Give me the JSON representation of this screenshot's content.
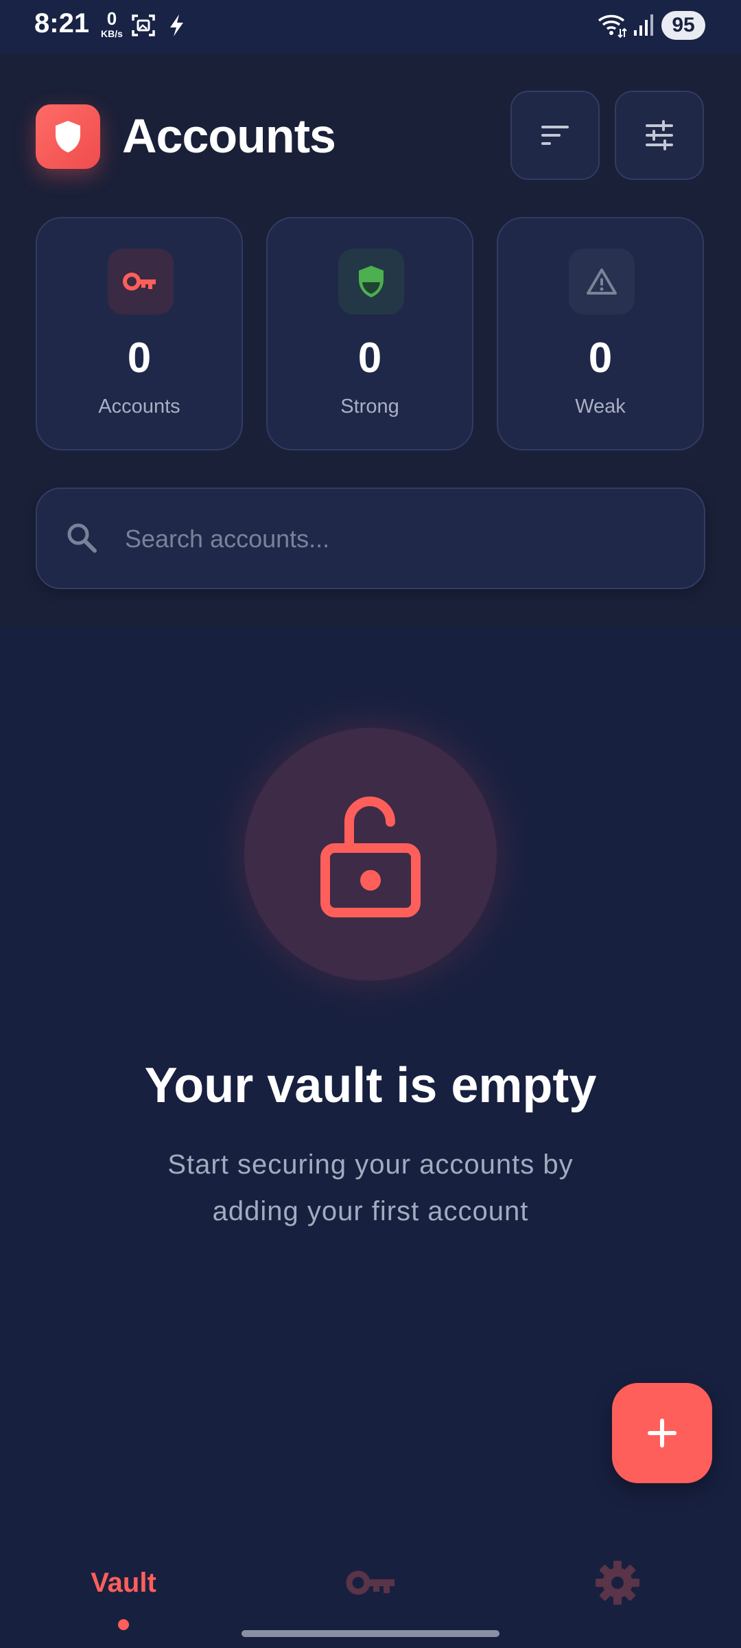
{
  "status_bar": {
    "time": "8:21",
    "net_speed_value": "0",
    "net_speed_unit": "KB/s",
    "battery": "95",
    "icons": [
      "screenshot-icon",
      "flash-icon",
      "wifi-icon",
      "signal-icon"
    ]
  },
  "header": {
    "title": "Accounts",
    "logo_icon": "shield-icon",
    "sort_icon": "sort-icon",
    "filter_icon": "sliders-icon"
  },
  "stats": [
    {
      "value": "0",
      "label": "Accounts",
      "icon": "key-icon",
      "color": "#ff5f5a"
    },
    {
      "value": "0",
      "label": "Strong",
      "icon": "shield-check-icon",
      "color": "#4caf50"
    },
    {
      "value": "0",
      "label": "Weak",
      "icon": "warning-icon",
      "color": "#7b8398"
    }
  ],
  "search": {
    "placeholder": "Search accounts..."
  },
  "empty_state": {
    "icon": "unlock-icon",
    "title": "Your vault is empty",
    "subtitle_line1": "Start securing your accounts by",
    "subtitle_line2": "adding your first account"
  },
  "fab": {
    "icon": "plus-icon"
  },
  "bottom_nav": {
    "vault_label": "Vault",
    "passwords_icon": "key-icon",
    "settings_icon": "gear-icon",
    "active": "Vault"
  },
  "colors": {
    "accent": "#ff5f5a",
    "background": "#182040",
    "card": "#1f2849"
  }
}
